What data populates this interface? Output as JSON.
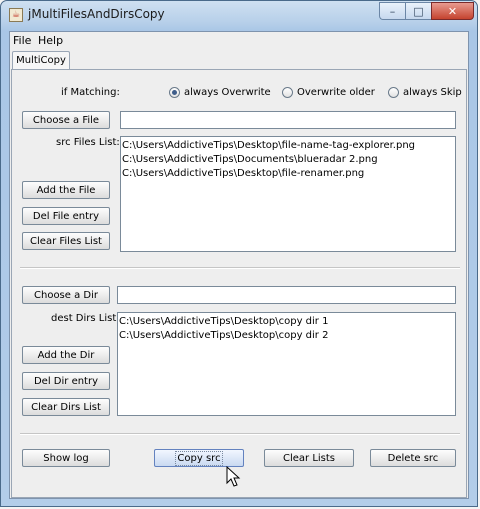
{
  "window": {
    "title": "jMultiFilesAndDirsCopy",
    "app_icon_glyph": "☕",
    "controls": {
      "minimize": "–",
      "maximize": "□",
      "close": "✕"
    }
  },
  "menu": {
    "file": "File",
    "help": "Help"
  },
  "tab": {
    "label": "MultiCopy"
  },
  "matching": {
    "label": "if Matching:",
    "options": [
      {
        "label": "always Overwrite",
        "selected": true
      },
      {
        "label": "Overwrite older",
        "selected": false
      },
      {
        "label": "always Skip",
        "selected": false
      }
    ]
  },
  "files": {
    "choose_button": "Choose a File",
    "input_value": "",
    "list_label": "src Files List:",
    "items": [
      "C:\\Users\\AddictiveTips\\Desktop\\file-name-tag-explorer.png",
      "C:\\Users\\AddictiveTips\\Documents\\blueradar 2.png",
      "C:\\Users\\AddictiveTips\\Desktop\\file-renamer.png"
    ],
    "add_button": "Add the File",
    "del_button": "Del File entry",
    "clear_button": "Clear Files List"
  },
  "dirs": {
    "choose_button": "Choose a Dir",
    "input_value": "",
    "list_label": "dest Dirs List:",
    "items": [
      "C:\\Users\\AddictiveTips\\Desktop\\copy dir 1",
      "C:\\Users\\AddictiveTips\\Desktop\\copy dir 2"
    ],
    "add_button": "Add the Dir",
    "del_button": "Del Dir entry",
    "clear_button": "Clear Dirs List"
  },
  "bottom": {
    "show_log": "Show log",
    "copy_src": "Copy src",
    "clear_lists": "Clear Lists",
    "delete_src": "Delete src"
  }
}
